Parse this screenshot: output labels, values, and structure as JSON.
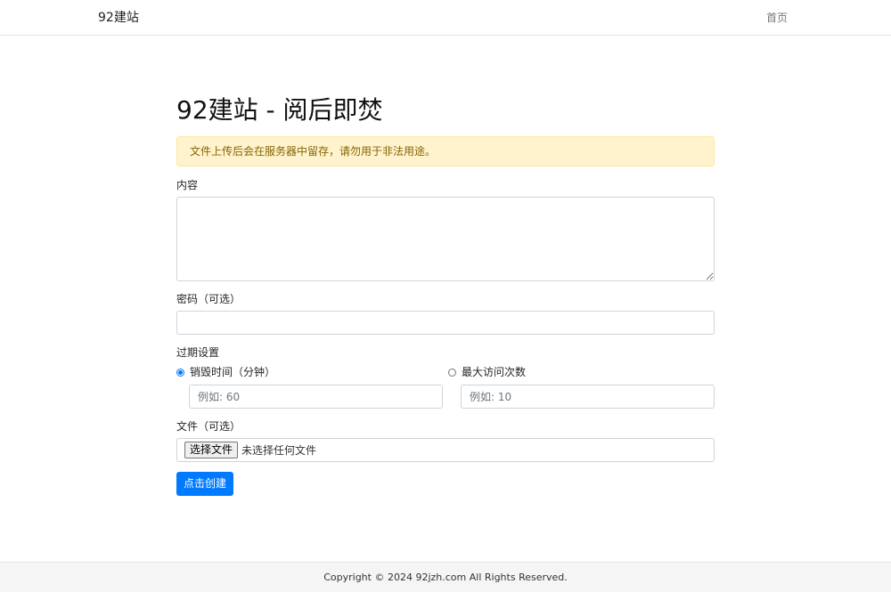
{
  "nav": {
    "brand": "92建站",
    "home": "首页"
  },
  "main": {
    "title": "92建站 - 阅后即焚",
    "alert": "文件上传后会在服务器中留存，请勿用于非法用途。",
    "content_label": "内容",
    "content_value": "",
    "password_label": "密码（可选）",
    "password_value": "",
    "expiry_label": "过期设置",
    "expiry": {
      "options": [
        {
          "label": "销毁时间（分钟）",
          "placeholder": "例如: 60",
          "checked": true
        },
        {
          "label": "最大访问次数",
          "placeholder": "例如: 10",
          "checked": false
        }
      ]
    },
    "file_label": "文件（可选）",
    "file_button": "选择文件",
    "file_status": "未选择任何文件",
    "submit": "点击创建"
  },
  "footer": {
    "copyright": "Copyright © 2024 92jzh.com All Rights Reserved."
  },
  "colors": {
    "primary": "#007bff",
    "alert_bg": "#fff3cd",
    "alert_text": "#856404"
  }
}
